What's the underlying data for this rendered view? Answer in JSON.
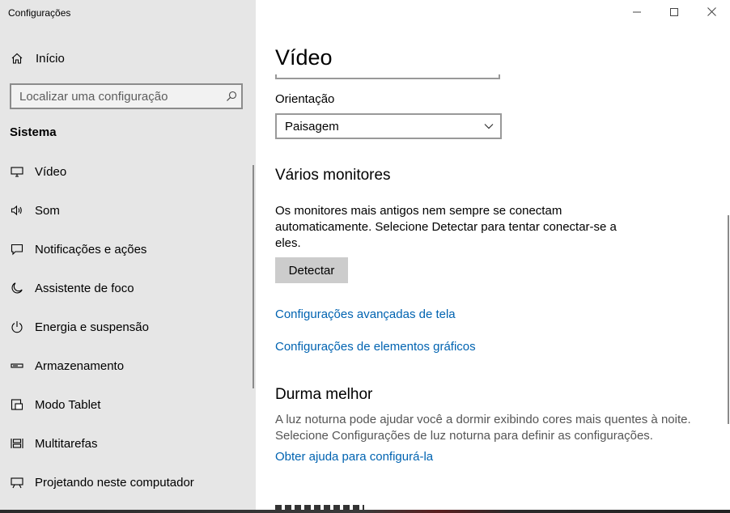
{
  "window": {
    "title": "Configurações",
    "controls": [
      "minimize-icon",
      "maximize-icon",
      "close-icon"
    ]
  },
  "sidebar": {
    "home_label": "Início",
    "search_placeholder": "Localizar uma configuração",
    "section": "Sistema",
    "items": [
      {
        "label": "Vídeo",
        "icon": "monitor-icon"
      },
      {
        "label": "Som",
        "icon": "speaker-icon"
      },
      {
        "label": "Notificações e ações",
        "icon": "notification-icon"
      },
      {
        "label": "Assistente de foco",
        "icon": "moon-icon"
      },
      {
        "label": "Energia e suspensão",
        "icon": "power-icon"
      },
      {
        "label": "Armazenamento",
        "icon": "storage-icon"
      },
      {
        "label": "Modo Tablet",
        "icon": "tablet-mode-icon"
      },
      {
        "label": "Multitarefas",
        "icon": "multitasking-icon"
      },
      {
        "label": "Projetando neste computador",
        "icon": "projecting-icon"
      }
    ]
  },
  "main": {
    "title": "Vídeo",
    "orientation_label": "Orientação",
    "orientation_value": "Paisagem",
    "multi_monitor": {
      "heading": "Vários monitores",
      "description": "Os monitores mais antigos nem sempre se conectam automaticamente. Selecione Detectar para tentar conectar-se a eles.",
      "detect_button": "Detectar"
    },
    "links": {
      "advanced_display": "Configurações avançadas de tela",
      "graphics": "Configurações de elementos gráficos"
    },
    "sleep_better": {
      "heading": "Durma melhor",
      "description": "A luz noturna pode ajudar você a dormir exibindo cores mais quentes à noite. Selecione Configurações de luz noturna para definir as configurações.",
      "help_link": "Obter ajuda para configurá-la"
    }
  },
  "colors": {
    "sidebar_bg": "#e6e6e6",
    "link": "#0063b1",
    "button_bg": "#cccccc"
  }
}
